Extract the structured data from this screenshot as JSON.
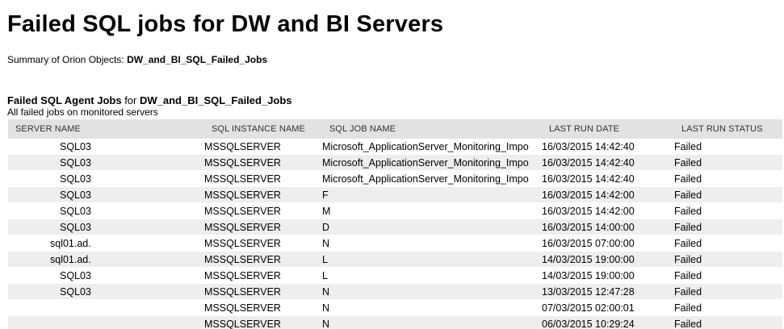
{
  "page": {
    "title": "Failed SQL jobs for DW and BI Servers",
    "summary_label": "Summary of Orion Objects:",
    "summary_value": "DW_and_BI_SQL_Failed_Jobs"
  },
  "section": {
    "title_bold": "Failed SQL Agent Jobs",
    "title_for": " for ",
    "title_value": "DW_and_BI_SQL_Failed_Jobs",
    "subtitle": "All failed jobs on monitored servers"
  },
  "table": {
    "columns": [
      "SERVER NAME",
      "SQL INSTANCE NAME",
      "SQL JOB NAME",
      "LAST RUN DATE",
      "LAST RUN STATUS"
    ],
    "rows": [
      {
        "server": "SQL03",
        "instance": "MSSQLSERVER",
        "job": "Microsoft_ApplicationServer_Monitoring_Impo",
        "date": "16/03/2015 14:42:40",
        "status": "Failed"
      },
      {
        "server": "SQL03",
        "instance": "MSSQLSERVER",
        "job": "Microsoft_ApplicationServer_Monitoring_Impo",
        "date": "16/03/2015 14:42:40",
        "status": "Failed"
      },
      {
        "server": "SQL03",
        "instance": "MSSQLSERVER",
        "job": "Microsoft_ApplicationServer_Monitoring_Impo",
        "date": "16/03/2015 14:42:40",
        "status": "Failed"
      },
      {
        "server": "SQL03",
        "instance": "MSSQLSERVER",
        "job": "F",
        "date": "16/03/2015 14:42:00",
        "status": "Failed"
      },
      {
        "server": "SQL03",
        "instance": "MSSQLSERVER",
        "job": "M",
        "date": "16/03/2015 14:42:00",
        "status": "Failed"
      },
      {
        "server": "SQL03",
        "instance": "MSSQLSERVER",
        "job": "D",
        "date": "16/03/2015 14:00:00",
        "status": "Failed"
      },
      {
        "server": "sql01.ad.",
        "instance": "MSSQLSERVER",
        "job": "N",
        "date": "16/03/2015 07:00:00",
        "status": "Failed"
      },
      {
        "server": "sql01.ad.",
        "instance": "MSSQLSERVER",
        "job": "L",
        "date": "14/03/2015 19:00:00",
        "status": "Failed"
      },
      {
        "server": "SQL03",
        "instance": "MSSQLSERVER",
        "job": "L",
        "date": "14/03/2015 19:00:00",
        "status": "Failed"
      },
      {
        "server": "SQL03",
        "instance": "MSSQLSERVER",
        "job": "N",
        "date": "13/03/2015 12:47:28",
        "status": "Failed"
      },
      {
        "server": "",
        "instance": "MSSQLSERVER",
        "job": "N",
        "date": "07/03/2015 02:00:01",
        "status": "Failed"
      },
      {
        "server": "",
        "instance": "MSSQLSERVER",
        "job": "N",
        "date": "06/03/2015 10:29:24",
        "status": "Failed"
      }
    ]
  },
  "colors": {
    "header_bg": "#e2e2e2",
    "row_alt_bg": "#eeeeee",
    "row_bg": "#ffffff"
  }
}
